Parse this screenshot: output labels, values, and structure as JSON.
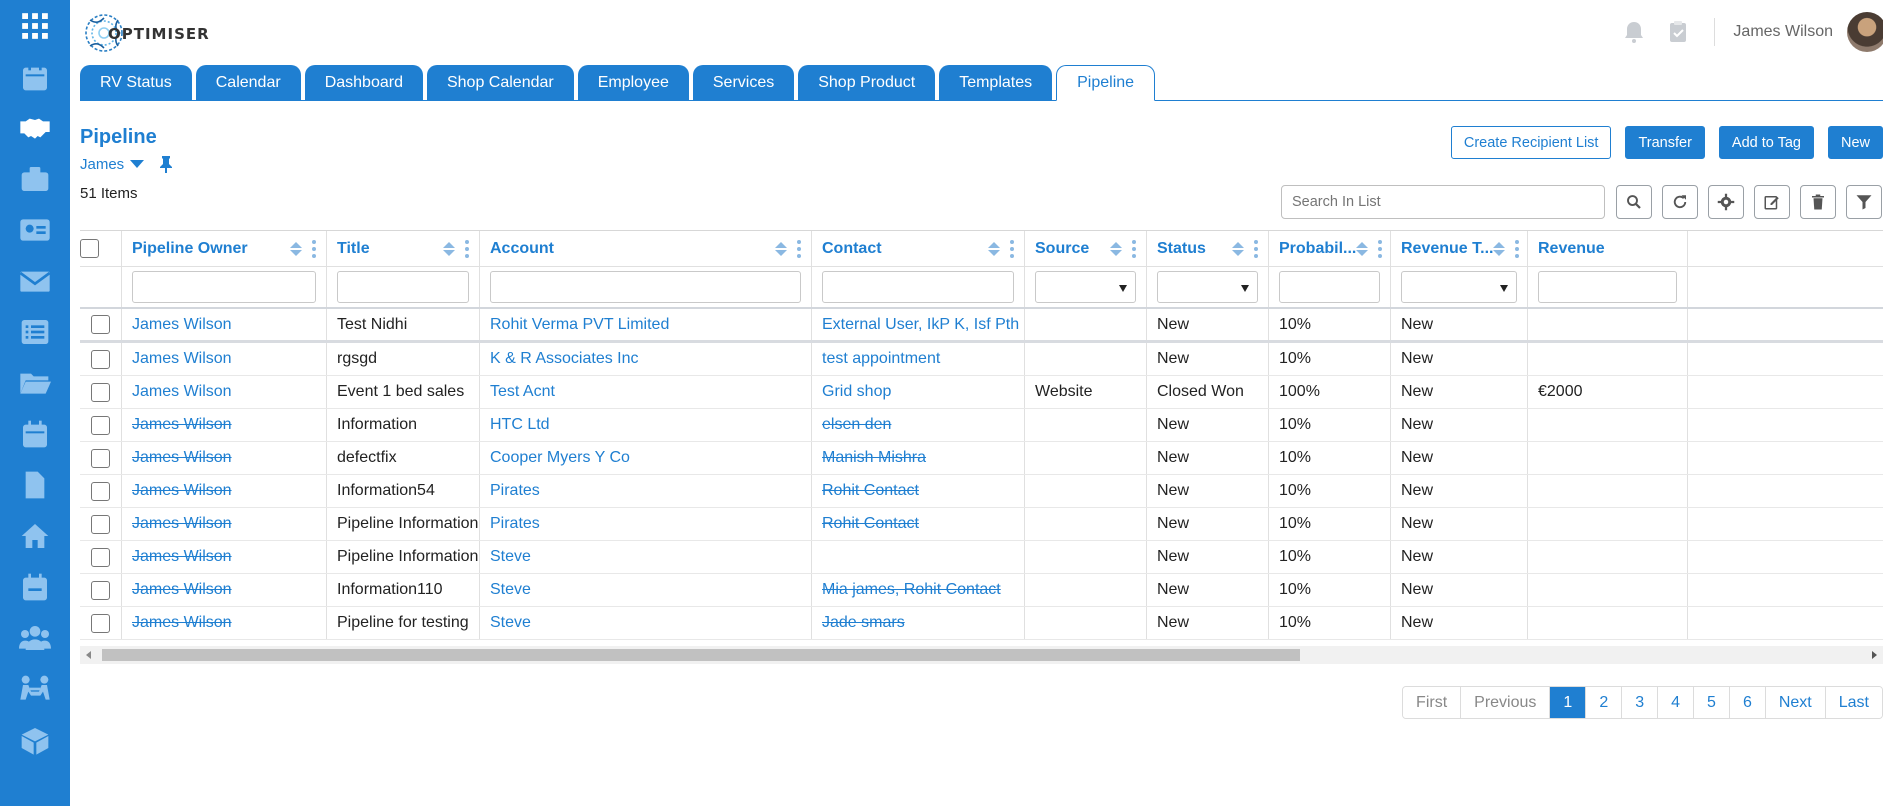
{
  "app": {
    "logo_text": "OPTIMISER",
    "user_name": "James Wilson",
    "accent_color": "#1f7fd1"
  },
  "rail_icons": [
    "grid-menu-icon",
    "calendar-icon",
    "handshake-icon",
    "briefcase-icon",
    "contact-card-icon",
    "envelope-icon",
    "list-icon",
    "folder-icon",
    "calendar-days-icon",
    "document-icon",
    "home-icon",
    "calendar-check-icon",
    "users-icon",
    "meeting-icon",
    "box-icon"
  ],
  "tabs": [
    {
      "label": "RV Status"
    },
    {
      "label": "Calendar"
    },
    {
      "label": "Dashboard"
    },
    {
      "label": "Shop Calendar"
    },
    {
      "label": "Employee"
    },
    {
      "label": "Services"
    },
    {
      "label": "Shop Product"
    },
    {
      "label": "Templates"
    },
    {
      "label": "Pipeline",
      "active": true
    }
  ],
  "page": {
    "title": "Pipeline",
    "view": "James",
    "items_count": "51 Items"
  },
  "actions": {
    "create_recipient_list": "Create Recipient List",
    "transfer": "Transfer",
    "add_to_tag": "Add to Tag",
    "new": "New"
  },
  "search": {
    "placeholder": "Search In List"
  },
  "columns": [
    "Pipeline Owner",
    "Title",
    "Account",
    "Contact",
    "Source",
    "Status",
    "Probabil...",
    "Revenue T...",
    "Revenue"
  ],
  "rows": [
    {
      "owner": "James Wilson",
      "owner_strike": false,
      "title": "Test Nidhi",
      "account": "Rohit Verma PVT Limited",
      "contact": "External User, IkP K, Isf Pth",
      "contact_strike": false,
      "source": "",
      "status": "New",
      "probability": "10%",
      "revenue_type": "New",
      "revenue": ""
    },
    {
      "owner": "James Wilson",
      "owner_strike": false,
      "title": "rgsgd",
      "account": "K & R Associates Inc",
      "contact": "test appointment",
      "contact_strike": false,
      "source": "",
      "status": "New",
      "probability": "10%",
      "revenue_type": "New",
      "revenue": ""
    },
    {
      "owner": "James Wilson",
      "owner_strike": false,
      "title": "Event 1 bed sales",
      "account": "Test Acnt",
      "contact": "Grid shop",
      "contact_strike": false,
      "source": "Website",
      "status": "Closed Won",
      "probability": "100%",
      "revenue_type": "New",
      "revenue": "€2000"
    },
    {
      "owner": "James Wilson",
      "owner_strike": true,
      "title": "Information",
      "account": "HTC Ltd",
      "contact": "elsen den",
      "contact_strike": true,
      "source": "",
      "status": "New",
      "probability": "10%",
      "revenue_type": "New",
      "revenue": ""
    },
    {
      "owner": "James Wilson",
      "owner_strike": true,
      "title": "defectfix",
      "account": "Cooper Myers Y Co",
      "contact": "Manish Mishra",
      "contact_strike": true,
      "source": "",
      "status": "New",
      "probability": "10%",
      "revenue_type": "New",
      "revenue": ""
    },
    {
      "owner": "James Wilson",
      "owner_strike": true,
      "title": "Information54",
      "account": "Pirates",
      "contact": "Rohit Contact",
      "contact_strike": true,
      "source": "",
      "status": "New",
      "probability": "10%",
      "revenue_type": "New",
      "revenue": ""
    },
    {
      "owner": "James Wilson",
      "owner_strike": true,
      "title": "Pipeline Information...",
      "account": "Pirates",
      "contact": "Rohit Contact",
      "contact_strike": true,
      "source": "",
      "status": "New",
      "probability": "10%",
      "revenue_type": "New",
      "revenue": ""
    },
    {
      "owner": "James Wilson",
      "owner_strike": true,
      "title": "Pipeline Information...",
      "account": "Steve",
      "contact": "",
      "contact_strike": false,
      "source": "",
      "status": "New",
      "probability": "10%",
      "revenue_type": "New",
      "revenue": ""
    },
    {
      "owner": "James Wilson",
      "owner_strike": true,
      "title": "Information110",
      "account": "Steve",
      "contact": "Mia james, Rohit Contact",
      "contact_strike": true,
      "source": "",
      "status": "New",
      "probability": "10%",
      "revenue_type": "New",
      "revenue": ""
    },
    {
      "owner": "James Wilson",
      "owner_strike": true,
      "title": "Pipeline for testing",
      "account": "Steve",
      "contact": "Jade smars",
      "contact_strike": true,
      "source": "",
      "status": "New",
      "probability": "10%",
      "revenue_type": "New",
      "revenue": ""
    }
  ],
  "pagination": {
    "first": "First",
    "previous": "Previous",
    "pages": [
      "1",
      "2",
      "3",
      "4",
      "5",
      "6"
    ],
    "current": "1",
    "next": "Next",
    "last": "Last"
  }
}
